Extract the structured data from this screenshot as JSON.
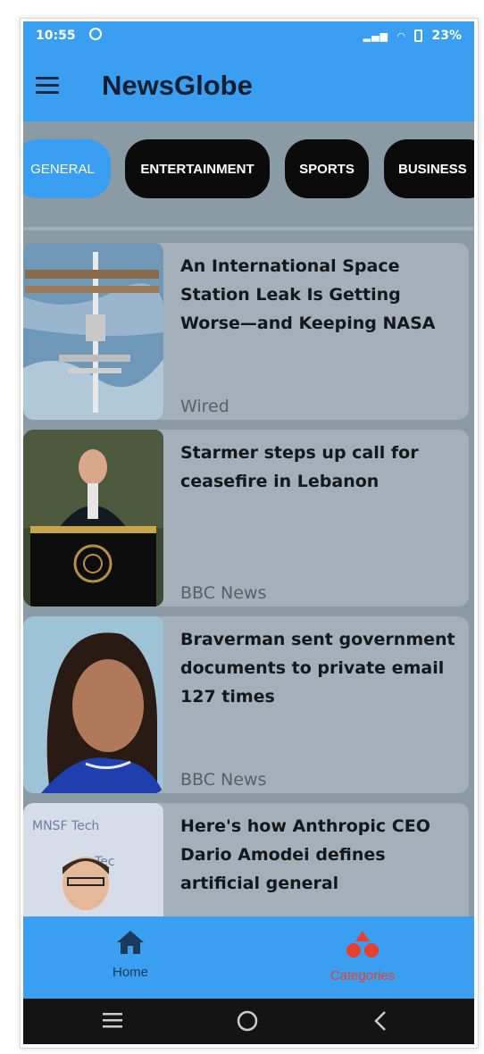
{
  "status_bar": {
    "time": "10:55",
    "battery": "23%"
  },
  "app_bar": {
    "title": "NewsGlobe"
  },
  "categories": [
    {
      "label": "GENERAL",
      "active": true
    },
    {
      "label": "ENTERTAINMENT",
      "active": false
    },
    {
      "label": "SPORTS",
      "active": false
    },
    {
      "label": "BUSINESS",
      "active": false
    }
  ],
  "articles": [
    {
      "title": "An International Space Station Leak Is Getting Worse—and Keeping NASA",
      "source": "Wired",
      "image": "space-station-image"
    },
    {
      "title": "Starmer steps up call for ceasefire in Lebanon",
      "source": "BBC News",
      "image": "speaker-at-podium-image"
    },
    {
      "title": "Braverman sent government documents to private email 127 times",
      "source": "BBC News",
      "image": "woman-portrait-image"
    },
    {
      "title": "Here's how Anthropic CEO Dario Amodei defines artificial general",
      "source": "",
      "image": "man-portrait-image"
    }
  ],
  "bottom_nav": {
    "home_label": "Home",
    "categories_label": "Categories",
    "active_color": "#1b3a5c",
    "accent_color": "#e8402f"
  },
  "colors": {
    "primary": "#3a9ff0",
    "background": "#8b9ba5",
    "card": "#a3b0b9"
  }
}
